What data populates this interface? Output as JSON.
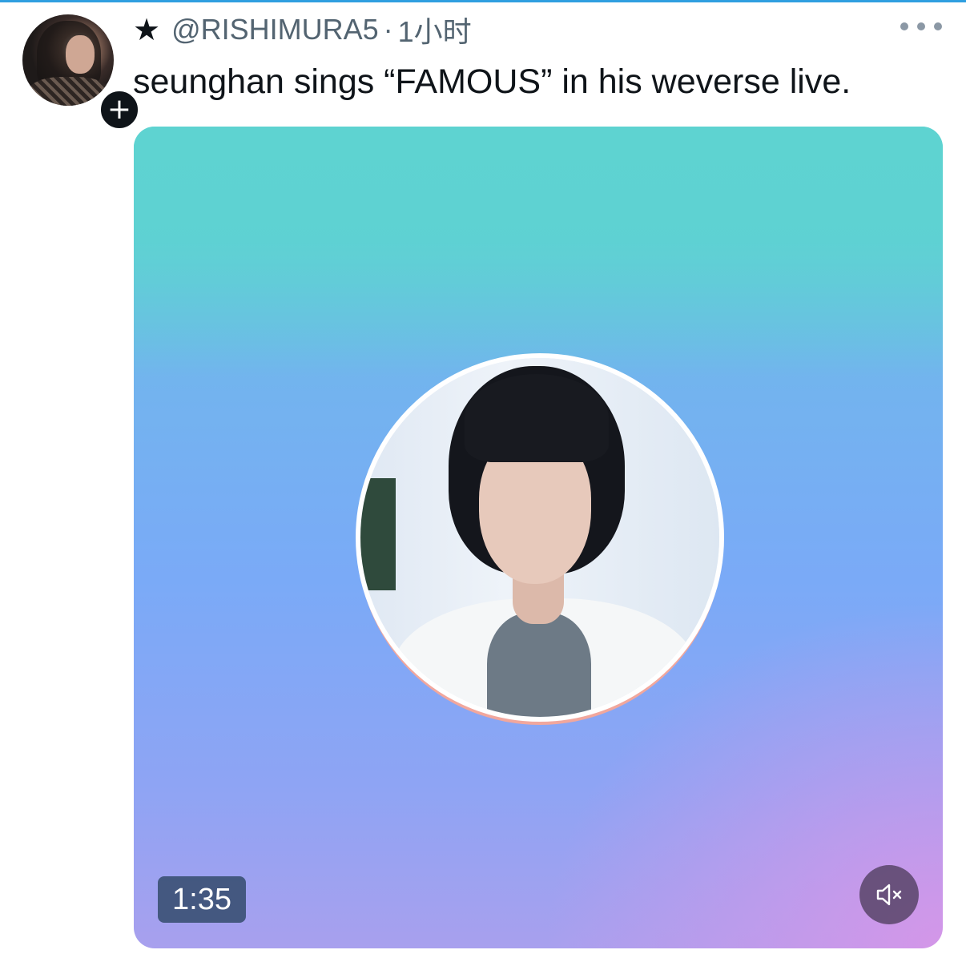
{
  "tweet": {
    "star": "★",
    "handle": "@RISHIMURA5",
    "separator": "·",
    "time": "1小时",
    "text": "seunghan sings “FAMOUS” in his weverse live.",
    "follow_symbol": "+"
  },
  "media": {
    "duration": "1:35",
    "muted": true
  },
  "icons": {
    "avatar": "user-avatar",
    "follow": "plus-icon",
    "more": "more-horizontal-icon",
    "mute": "volume-mute-icon"
  },
  "colors": {
    "accent_line": "#2f9fe0",
    "text_primary": "#0f1419",
    "text_secondary": "#536471"
  }
}
